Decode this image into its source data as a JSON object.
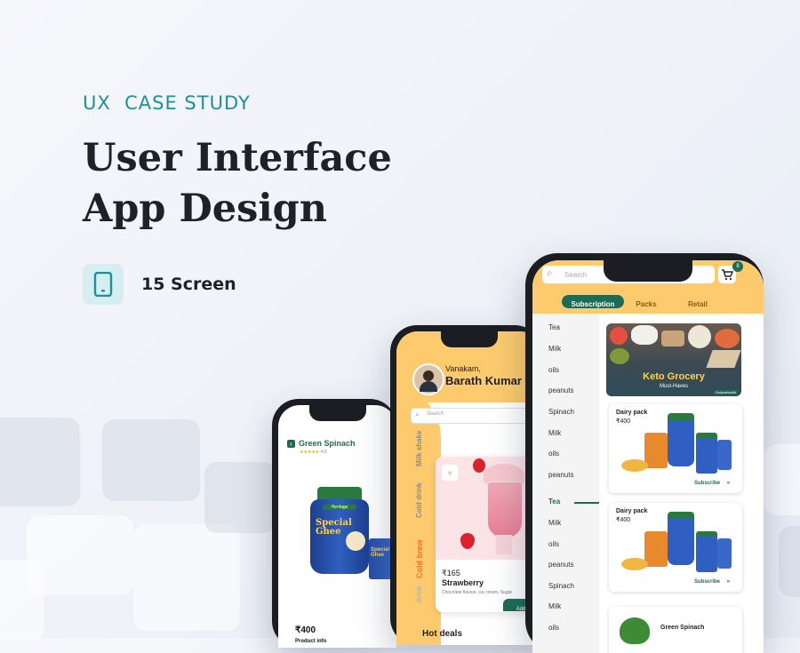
{
  "hero": {
    "eyebrow": "UX  CASE STUDY",
    "title_line1": "User Interface",
    "title_line2": "App Design",
    "screen_count": "15 Screen",
    "screen_icon": "mobile-phone-icon"
  },
  "phone_product": {
    "back_icon": "chevron-left-icon",
    "title": "Green Spinach",
    "rating_stars": "★★★★★",
    "rating_value": "4.5",
    "jar_brand": "Heritage",
    "jar_label": "Special Ghee",
    "pouch_label": "Special Ghee",
    "price": "₹400",
    "info_label": "Product info"
  },
  "phone_drinks": {
    "greeting": "Vanakam,",
    "user_name": "Barath Kumar",
    "search_placeholder": "Search",
    "categories": [
      "Milk shake",
      "Cold drink",
      "Cold brew",
      "drink"
    ],
    "active_category": "Cold brew",
    "product_price": "₹165",
    "product_name": "Strawberry",
    "product_desc": "Chocolate flavour, ice cream, Sugar",
    "add_label": "Add",
    "section_title": "Hot deals",
    "favorite_icon": "heart-icon"
  },
  "phone_grocery": {
    "search_placeholder": "Search",
    "cart_count": "8",
    "tabs": [
      "Subscription",
      "Packs",
      "Retail"
    ],
    "active_tab": "Subscription",
    "sidebar_items": [
      "Tea",
      "Milk",
      "oils",
      "peanuts",
      "Spinach",
      "Milk",
      "oils",
      "peanuts",
      "Tea",
      "Milk",
      "oils",
      "peanuts",
      "Spinach",
      "Milk",
      "oils"
    ],
    "active_sidebar_index": 8,
    "banner_title": "Keto Grocery",
    "banner_subtitle": "Must-Haves",
    "banner_badge": "Ostyoshealth",
    "cards": [
      {
        "name": "Dairy pack",
        "price": "₹400",
        "action": "Subscribe"
      },
      {
        "name": "Dairy pack",
        "price": "₹400",
        "action": "Subscribe"
      }
    ],
    "bottom_card_title": "Green Spinach"
  },
  "colors": {
    "accent_teal": "#1d8fa0",
    "brand_green": "#1e6b55",
    "header_yellow": "#fdcb6e",
    "active_orange": "#ff6b35"
  }
}
